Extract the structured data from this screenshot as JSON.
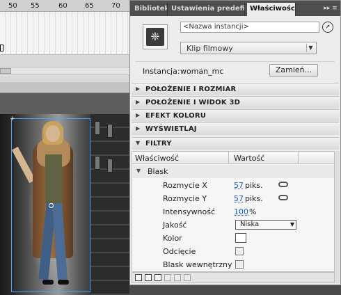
{
  "timeline": {
    "ruler_numbers": [
      "50",
      "55",
      "60",
      "65",
      "70"
    ]
  },
  "panel": {
    "tabs": [
      {
        "label": "Biblioteka",
        "active": false
      },
      {
        "label": "Ustawienia predefiniowane",
        "active": false
      },
      {
        "label": "Właściwości",
        "active": true
      }
    ],
    "tab_menu_icon": "panel-menu-icon",
    "symbol_icon": "movie-clip-symbol-icon",
    "instance_name_placeholder": "<Nazwa instancji>",
    "type_select_value": "Klip filmowy",
    "instance_label": "Instancja:",
    "instance_value": "woman_mc",
    "swap_button": "Zamień...",
    "sections": [
      {
        "title": "POŁOŻENIE I ROZMIAR",
        "expanded": false
      },
      {
        "title": "POŁOŻENIE I WIDOK 3D",
        "expanded": false
      },
      {
        "title": "EFEKT KOLORU",
        "expanded": false
      },
      {
        "title": "WYŚWIETLAJ",
        "expanded": false
      },
      {
        "title": "FILTRY",
        "expanded": true
      }
    ],
    "filters": {
      "col_property": "Właściwość",
      "col_value": "Wartość",
      "group_name": "Blask",
      "rows": [
        {
          "label": "Rozmycie X",
          "value": "57",
          "unit": "piks.",
          "linked": true
        },
        {
          "label": "Rozmycie Y",
          "value": "57",
          "unit": "piks.",
          "linked": true
        },
        {
          "label": "Intensywność",
          "value": "100",
          "unit": "%"
        },
        {
          "label": "Jakość",
          "select": "Niska"
        },
        {
          "label": "Kolor",
          "color": "#ffffff"
        },
        {
          "label": "Odcięcie",
          "checked": false
        },
        {
          "label": "Blask wewnętrzny",
          "checked": false
        }
      ]
    }
  },
  "colors": {
    "accent_blue": "#1a5ccc",
    "selection_blue": "#4aa3ff",
    "tabbar_dark": "#4f4f4f"
  }
}
